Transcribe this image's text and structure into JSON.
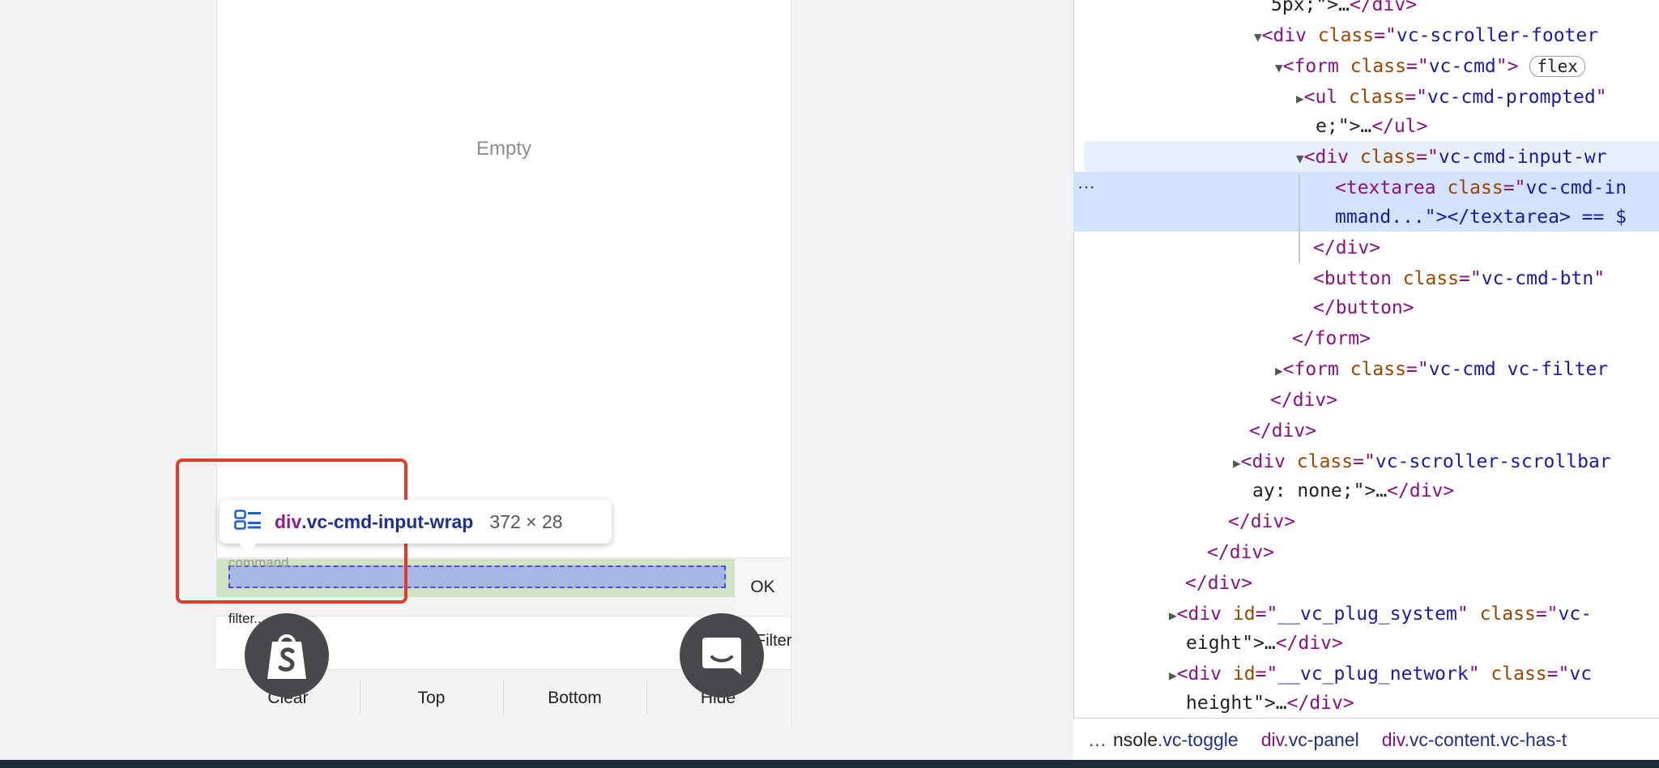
{
  "phone": {
    "empty_text": "Empty",
    "cmd_placeholder": "command...",
    "ok_label": "OK",
    "filter_placeholder": "filter...",
    "filter_button": "Filter",
    "toolbar": [
      "Clear",
      "Top",
      "Bottom",
      "Hide"
    ]
  },
  "tooltip": {
    "tag": "div",
    "class": ".vc-cmd-input-wrap",
    "size": "372 × 28",
    "icon": "layout-grid-icon"
  },
  "floating": {
    "left_icon": "shopify-bag-icon",
    "right_icon": "chat-bubble-icon"
  },
  "devtools": {
    "lines": [
      {
        "t": "5px;\">…</div>"
      },
      {
        "tag": "div",
        "attr": "class",
        "val": "vc-scroller-footer"
      },
      {
        "tag": "form",
        "attr": "class",
        "val": "vc-cmd",
        "badge": "flex"
      },
      {
        "tag": "ul",
        "attr": "class",
        "val": "vc-cmd-prompted"
      },
      {
        "t": "e;\">…</ul>"
      },
      {
        "tag": "div",
        "attr": "class",
        "val": "vc-cmd-input-wr"
      },
      {
        "tag": "textarea",
        "attr": "class",
        "val": "vc-cmd-in"
      },
      {
        "t": "mmand...\"></textarea> == $"
      },
      {
        "t": "</div>"
      },
      {
        "tag": "button",
        "attr": "class",
        "val": "vc-cmd-btn"
      },
      {
        "t": "</button>"
      },
      {
        "t": "</form>"
      },
      {
        "tag": "form",
        "attr": "class",
        "val": "vc-cmd vc-filter"
      },
      {
        "t": "</div>"
      },
      {
        "t": "</div>"
      },
      {
        "tag": "div",
        "attr": "class",
        "val": "vc-scroller-scrollbar"
      },
      {
        "t": "ay: none;\">…</div>"
      },
      {
        "t": "</div>"
      },
      {
        "t": "</div>"
      },
      {
        "t": "</div>"
      },
      {
        "tag": "div",
        "attr": "id",
        "val": "__vc_plug_system",
        "attr2": "class",
        "val2": "vc-"
      },
      {
        "t": "eight\">…</div>"
      },
      {
        "tag": "div",
        "attr": "id",
        "val": "__vc_plug_network",
        "attr2": "class",
        "val2": "vc"
      },
      {
        "t": "height\">…</div>"
      }
    ],
    "gutter_dots": "⋯",
    "breadcrumb": {
      "dots": "…",
      "items": [
        {
          "tag": "nsole",
          "cls": ".vc-toggle"
        },
        {
          "tag": "div",
          "cls": ".vc-panel"
        },
        {
          "tag": "div",
          "cls": ".vc-content.vc-has-t"
        }
      ]
    }
  },
  "colors": {
    "highlight": "#e33d2a",
    "tag": "#881280",
    "attr_name": "#994500",
    "attr_value": "#1a1aa6",
    "selection": "#d3e3fd"
  }
}
